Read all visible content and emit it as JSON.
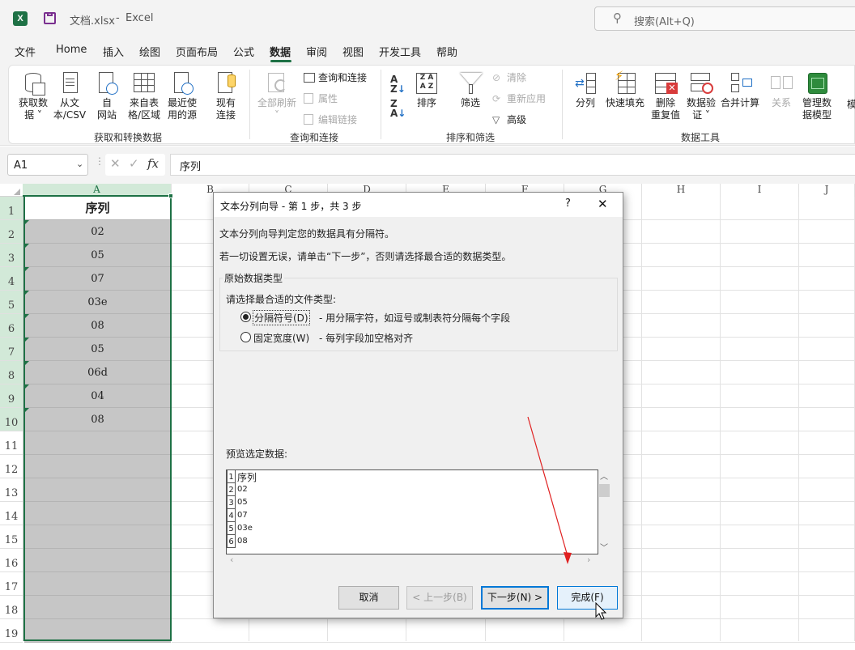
{
  "titlebar": {
    "filename": "文档.xlsx",
    "separator": "-",
    "app": "Excel",
    "search_placeholder": "搜索(Alt+Q)"
  },
  "tabs": [
    "文件",
    "Home",
    "插入",
    "绘图",
    "页面布局",
    "公式",
    "数据",
    "审阅",
    "视图",
    "开发工具",
    "帮助"
  ],
  "active_tab": "数据",
  "ribbon": {
    "groups": [
      {
        "label": "获取和转换数据"
      },
      {
        "label": "查询和连接"
      },
      {
        "label": "排序和筛选"
      },
      {
        "label": "数据工具"
      }
    ],
    "get_data": {
      "line1": "获取数",
      "line2": "据 ˅"
    },
    "from_text": {
      "line1": "从文",
      "line2": "本/CSV"
    },
    "from_web": {
      "line1": "自",
      "line2": "网站"
    },
    "from_table": {
      "line1": "来自表",
      "line2": "格/区域"
    },
    "recent": {
      "line1": "最近使",
      "line2": "用的源"
    },
    "existing": {
      "line1": "现有",
      "line2": "连接"
    },
    "refresh_all": {
      "line1": "全部刷新",
      "line2": "˅"
    },
    "queries": "查询和连接",
    "properties": "属性",
    "edit_links": "编辑链接",
    "sort": "排序",
    "filter": "筛选",
    "clear": "清除",
    "reapply": "重新应用",
    "advanced": "高级",
    "text_to_columns": "分列",
    "flash_fill": "快速填充",
    "remove_dup": {
      "line1": "删除",
      "line2": "重复值"
    },
    "data_validation": {
      "line1": "数据验",
      "line2": "证 ˅"
    },
    "consolidate": "合并计算",
    "relationships": "关系",
    "data_model": {
      "line1": "管理数",
      "line2": "据模型"
    },
    "cutoff": "模"
  },
  "formula_bar": {
    "name_box": "A1",
    "fx": "fx",
    "content": "序列"
  },
  "columns": [
    "A",
    "B",
    "C",
    "D",
    "E",
    "F",
    "G",
    "H",
    "I",
    "J"
  ],
  "rows": [
    "1",
    "2",
    "3",
    "4",
    "5",
    "6",
    "7",
    "8",
    "9",
    "10",
    "11",
    "12",
    "13",
    "14",
    "15",
    "16",
    "17",
    "18",
    "19"
  ],
  "column_a": [
    "序列",
    "02",
    "05",
    "07",
    "03e",
    "08",
    "05",
    "06d",
    "04",
    "08"
  ],
  "dialog": {
    "title": "文本分列向导 - 第 1 步，共 3 步",
    "help": "?",
    "close": "✕",
    "intro": "文本分列向导判定您的数据具有分隔符。",
    "instruction": "若一切设置无误，请单击“下一步”，否则请选择最合适的数据类型。",
    "group_label": "原始数据类型",
    "choose_label": "请选择最合适的文件类型:",
    "option_delimited": "分隔符号(D)",
    "option_delimited_desc": "- 用分隔字符，如逗号或制表符分隔每个字段",
    "option_fixed": "固定宽度(W)",
    "option_fixed_desc": "- 每列字段加空格对齐",
    "preview_label": "预览选定数据:",
    "preview_rows": [
      {
        "n": "1",
        "text": "序列"
      },
      {
        "n": "2",
        "text": "02"
      },
      {
        "n": "3",
        "text": "05"
      },
      {
        "n": "4",
        "text": "07"
      },
      {
        "n": "5",
        "text": "03e"
      },
      {
        "n": "6",
        "text": "08"
      }
    ],
    "buttons": {
      "cancel": "取消",
      "back": "< 上一步(B)",
      "next": "下一步(N) >",
      "finish": "完成(F)"
    }
  },
  "colors": {
    "excel_green": "#1e7145",
    "selected_fill": "#c6c6c6",
    "annotation_arrow": "#e02020",
    "focus_blue": "#0078d7"
  }
}
